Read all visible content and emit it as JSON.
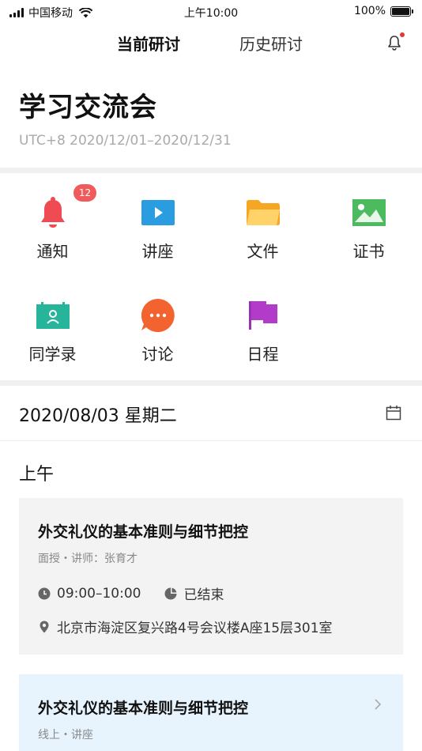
{
  "status_bar": {
    "carrier": "中国移动",
    "time": "上午10:00",
    "battery": "100%"
  },
  "tabs": {
    "current": "当前研讨",
    "history": "历史研讨"
  },
  "header": {
    "title": "学习交流会",
    "date_range": "UTC+8 2020/12/01–2020/12/31"
  },
  "grid": {
    "items": [
      {
        "label": "通知",
        "icon": "bell-icon",
        "badge": "12"
      },
      {
        "label": "讲座",
        "icon": "video-icon"
      },
      {
        "label": "文件",
        "icon": "folder-icon"
      },
      {
        "label": "证书",
        "icon": "image-icon"
      },
      {
        "label": "同学录",
        "icon": "contacts-icon"
      },
      {
        "label": "讨论",
        "icon": "chat-icon"
      },
      {
        "label": "日程",
        "icon": "flag-icon"
      }
    ]
  },
  "schedule": {
    "date": "2020/08/03 星期二",
    "period": "上午",
    "sessions": [
      {
        "title": "外交礼仪的基本准则与细节把控",
        "meta": "面授・讲师：张育才",
        "time": "09:00–10:00",
        "status": "已结束",
        "location": "北京市海淀区复兴路4号会议楼A座15层301室"
      },
      {
        "title": "外交礼仪的基本准则与细节把控",
        "meta": "线上・讲座"
      }
    ]
  },
  "colors": {
    "accent": "#5bc0eb",
    "badge": "#f05a5a",
    "bell": "#f04b52",
    "video": "#2a9de0",
    "folder": "#f7b84b",
    "image": "#4cbb5f",
    "contacts": "#26b49a",
    "chat": "#f2632f",
    "flag": "#b23cc9"
  }
}
